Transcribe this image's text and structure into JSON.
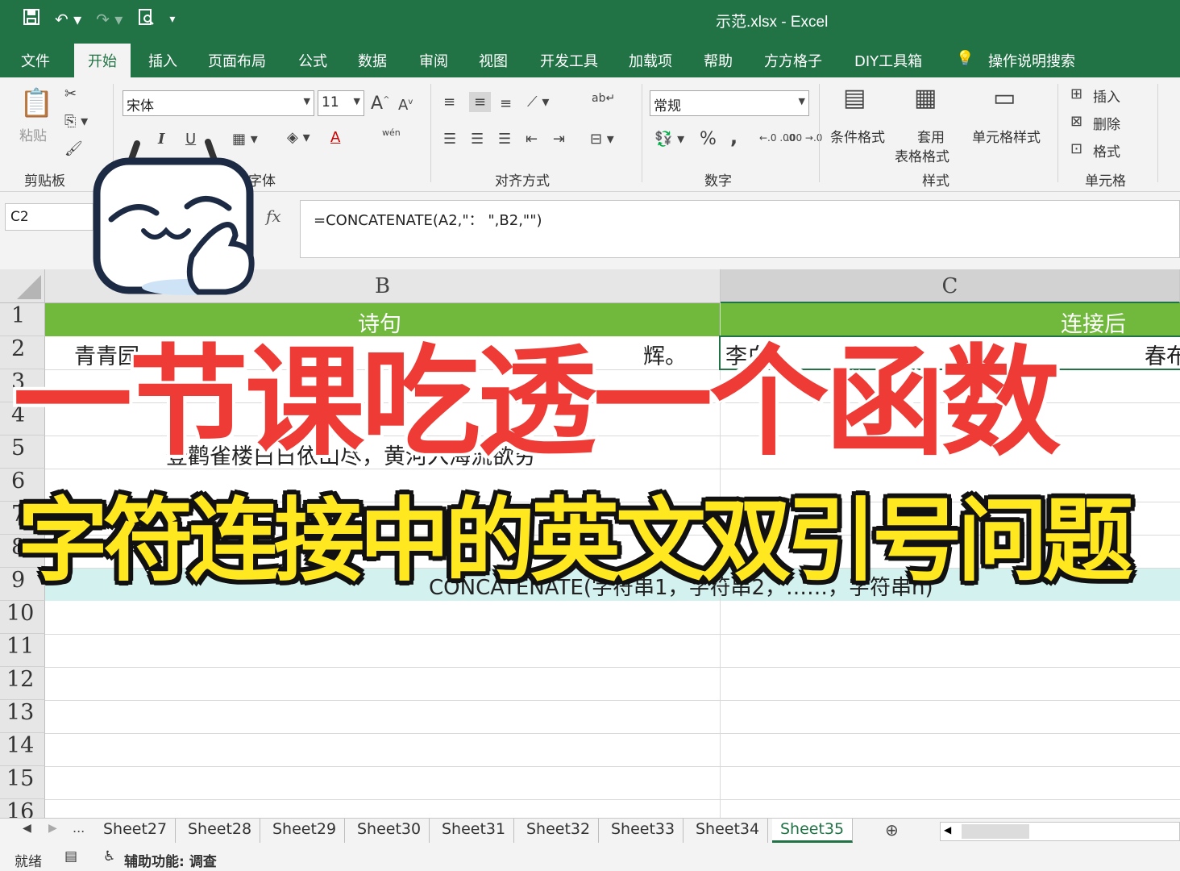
{
  "title_bar": {
    "document_title": "示范.xlsx  -  Excel",
    "qat_icons": [
      "save-icon",
      "undo-icon",
      "redo-icon",
      "print-preview-icon",
      "customize-icon"
    ]
  },
  "tabs": [
    "文件",
    "开始",
    "插入",
    "页面布局",
    "公式",
    "数据",
    "审阅",
    "视图",
    "开发工具",
    "加载项",
    "帮助",
    "方方格子",
    "DIY工具箱",
    "操作说明搜索"
  ],
  "active_tab": "开始",
  "ribbon": {
    "clipboard": {
      "paste": "粘贴",
      "label": "剪贴板"
    },
    "font": {
      "name": "宋体",
      "size": "11",
      "label": "字体",
      "bold": "B",
      "italic": "I",
      "underline": "U",
      "font_color": "A",
      "wen": "wén"
    },
    "alignment": {
      "label": "对齐方式"
    },
    "number": {
      "format": "常规",
      "label": "数字",
      "percent": "%",
      "comma": ",",
      "inc": "←.0 .00",
      "dec": ".00 →.0"
    },
    "styles": {
      "conditional": "条件格式",
      "table": "套用\n表格格式",
      "table_1": "套用",
      "table_2": "表格格式",
      "cell_styles": "单元格样式",
      "label": "样式"
    },
    "cells": {
      "insert": "插入",
      "delete": "删除",
      "format": "格式",
      "label": "单元格"
    }
  },
  "formula_bar": {
    "name_box": "C2",
    "fx": "fx",
    "formula": "=CONCATENATE(A2,\"：  \",B2,\"\")"
  },
  "grid": {
    "columns": [
      "B",
      "C"
    ],
    "rows": [
      "1",
      "2",
      "3",
      "4",
      "5",
      "6",
      "7",
      "8",
      "9",
      "10",
      "11",
      "12",
      "13",
      "14",
      "15",
      "16"
    ],
    "cells": {
      "b1": "诗句",
      "c1": "连接后",
      "b2_left": "青青园",
      "b2_right": "辉。",
      "c2_left": "李白",
      "c2_right": "春布",
      "b5": "登鹳雀楼白日依山尽，黄河入海流欲穷",
      "row9": "CONCATENATE(字符串1，字符串2，……，字符串n)"
    }
  },
  "overlay": {
    "title_line1": "一节课吃透一个函数",
    "title_line2": "字符连接中的英文双引号问题"
  },
  "sheet_tabs": [
    "Sheet27",
    "Sheet28",
    "Sheet29",
    "Sheet30",
    "Sheet31",
    "Sheet32",
    "Sheet33",
    "Sheet34",
    "Sheet35"
  ],
  "active_sheet": "Sheet35",
  "sheet_nav": "...",
  "status": {
    "ready": "就绪",
    "accessibility": "辅助功能: 调查"
  },
  "colors": {
    "excel_green": "#217346",
    "header_row": "#70b93c",
    "row9": "#d3f1ef",
    "title_red": "#ef3b35",
    "title_yellow": "#ffe81f"
  }
}
